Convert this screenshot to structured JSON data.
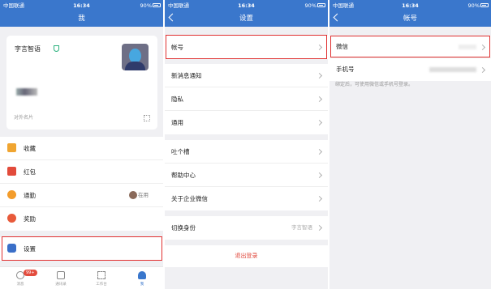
{
  "status_bar": {
    "carrier": "中国联通",
    "time": "16:34",
    "battery": "90%"
  },
  "panel_me": {
    "title": "我",
    "profile": {
      "name": "字言智语",
      "ext_card_label": "对外名片"
    },
    "menu": [
      {
        "label": "收藏",
        "icon": "box-icon",
        "color": "#f0a531"
      },
      {
        "label": "红包",
        "icon": "red-packet-icon",
        "color": "#e24b3b"
      },
      {
        "label": "通勤",
        "icon": "clock-icon",
        "color": "#f39c2b",
        "value": "在用"
      },
      {
        "label": "奖励",
        "icon": "medal-icon",
        "color": "#e85a3a"
      }
    ],
    "settings_label": "设置",
    "tabs": [
      {
        "label": "消息",
        "badge": "99+"
      },
      {
        "label": "通讯录"
      },
      {
        "label": "工作台"
      },
      {
        "label": "我"
      }
    ]
  },
  "panel_settings": {
    "title": "设置",
    "group1": [
      "帐号"
    ],
    "group2": [
      "新消息通知",
      "隐私",
      "通用"
    ],
    "group3": [
      "吐个槽",
      "帮助中心",
      "关于企业微信"
    ],
    "switch_identity": {
      "label": "切换身份",
      "value": "字言智语"
    },
    "logout": "退出登录"
  },
  "panel_account": {
    "title": "帐号",
    "rows": [
      {
        "label": "微信"
      },
      {
        "label": "手机号"
      }
    ],
    "hint": "绑定后，可使用微信或手机号登录。"
  },
  "colors": {
    "header": "#3a77cc",
    "highlight_box": "#e03030",
    "logout_text": "#e0463a"
  }
}
